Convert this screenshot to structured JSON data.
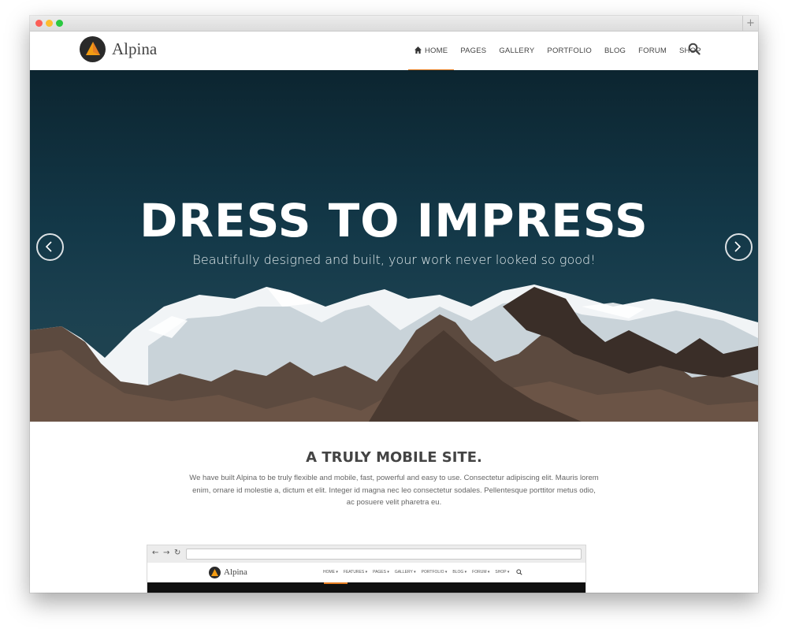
{
  "brand": {
    "name": "Alpina",
    "accent": "#e67e22"
  },
  "nav": {
    "items": [
      {
        "label": "HOME",
        "icon": "home-icon",
        "active": true
      },
      {
        "label": "PAGES"
      },
      {
        "label": "GALLERY"
      },
      {
        "label": "PORTFOLIO"
      },
      {
        "label": "BLOG"
      },
      {
        "label": "FORUM"
      },
      {
        "label": "SHOP"
      }
    ],
    "search_icon": "search-icon"
  },
  "hero": {
    "title": "DRESS TO IMPRESS",
    "subtitle": "Beautifully designed and built, your work never looked so good!",
    "slides_total": 2,
    "active_slide": 1
  },
  "section": {
    "title": "A TRULY MOBILE SITE.",
    "body": "We have built Alpina to be truly flexible and mobile, fast, powerful and easy to use. Consectetur adipiscing elit. Mauris lorem enim, ornare id molestie a, dictum et elit. Integer id magna nec leo consectetur sodales. Pellentesque porttitor metus odio, ac posuere velit pharetra eu."
  },
  "preview": {
    "brand": "Alpina",
    "nav": [
      "HOME ▾",
      "FEATURES ▾",
      "PAGES ▾",
      "GALLERY ▾",
      "PORTFOLIO ▾",
      "BLOG ▾",
      "FORUM ▾",
      "SHOP ▾"
    ]
  }
}
